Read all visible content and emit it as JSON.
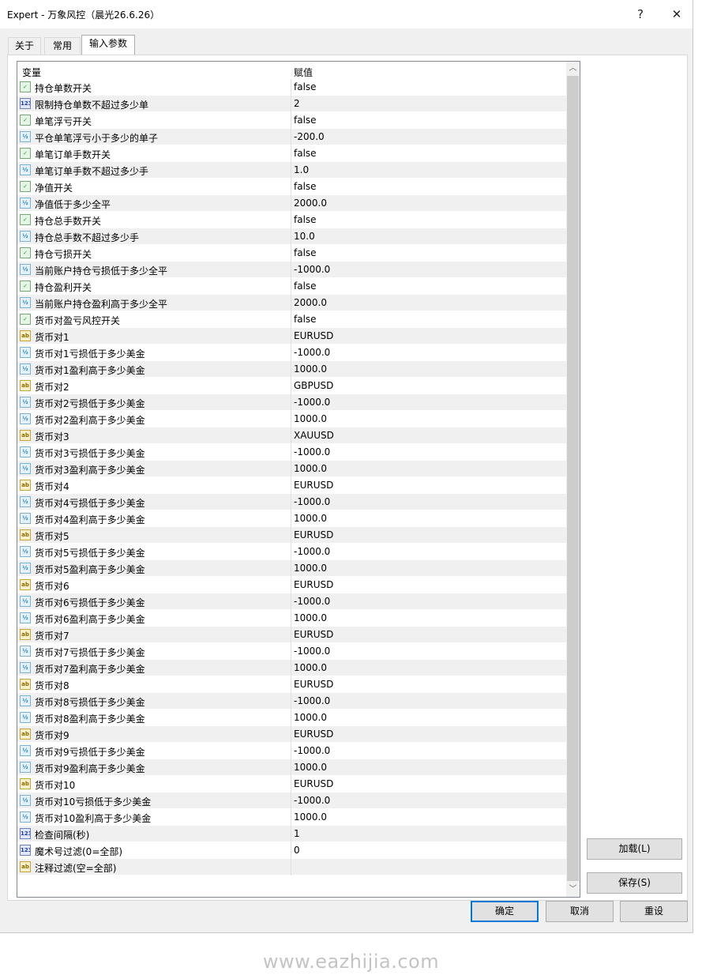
{
  "window": {
    "title": "Expert - 万象风控（晨光26.6.26）",
    "help_glyph": "?",
    "close_glyph": "✕"
  },
  "tabs": [
    {
      "label": "关于",
      "active": false
    },
    {
      "label": "常用",
      "active": false
    },
    {
      "label": "输入参数",
      "active": true
    }
  ],
  "grid": {
    "col_variable": "变量",
    "col_value": "赋值",
    "rows": [
      {
        "icon": "bool-icon",
        "badge": "✓",
        "name": "持仓单数开关",
        "value": "false"
      },
      {
        "icon": "int-icon",
        "badge": "123",
        "name": "限制持仓单数不超过多少单",
        "value": "2"
      },
      {
        "icon": "bool-icon",
        "badge": "✓",
        "name": "单笔浮亏开关",
        "value": "false"
      },
      {
        "icon": "double-icon",
        "badge": "½",
        "name": "平仓单笔浮亏小于多少的单子",
        "value": "-200.0"
      },
      {
        "icon": "bool-icon",
        "badge": "✓",
        "name": "单笔订单手数开关",
        "value": "false"
      },
      {
        "icon": "double-icon",
        "badge": "½",
        "name": "单笔订单手数不超过多少手",
        "value": "1.0"
      },
      {
        "icon": "bool-icon",
        "badge": "✓",
        "name": "净值开关",
        "value": "false"
      },
      {
        "icon": "double-icon",
        "badge": "½",
        "name": "净值低于多少全平",
        "value": "2000.0"
      },
      {
        "icon": "bool-icon",
        "badge": "✓",
        "name": "持仓总手数开关",
        "value": "false"
      },
      {
        "icon": "double-icon",
        "badge": "½",
        "name": "持仓总手数不超过多少手",
        "value": "10.0"
      },
      {
        "icon": "bool-icon",
        "badge": "✓",
        "name": "持仓亏损开关",
        "value": "false"
      },
      {
        "icon": "double-icon",
        "badge": "½",
        "name": "当前账户持仓亏损低于多少全平",
        "value": "-1000.0"
      },
      {
        "icon": "bool-icon",
        "badge": "✓",
        "name": "持仓盈利开关",
        "value": "false"
      },
      {
        "icon": "double-icon",
        "badge": "½",
        "name": "当前账户持仓盈利高于多少全平",
        "value": "2000.0"
      },
      {
        "icon": "bool-icon",
        "badge": "✓",
        "name": "货币对盈亏风控开关",
        "value": "false"
      },
      {
        "icon": "string-icon",
        "badge": "ab",
        "name": "货币对1",
        "value": "EURUSD"
      },
      {
        "icon": "double-icon",
        "badge": "½",
        "name": "货币对1亏损低于多少美金",
        "value": "-1000.0"
      },
      {
        "icon": "double-icon",
        "badge": "½",
        "name": "货币对1盈利高于多少美金",
        "value": "1000.0"
      },
      {
        "icon": "string-icon",
        "badge": "ab",
        "name": "货币对2",
        "value": "GBPUSD"
      },
      {
        "icon": "double-icon",
        "badge": "½",
        "name": "货币对2亏损低于多少美金",
        "value": "-1000.0"
      },
      {
        "icon": "double-icon",
        "badge": "½",
        "name": "货币对2盈利高于多少美金",
        "value": "1000.0"
      },
      {
        "icon": "string-icon",
        "badge": "ab",
        "name": "货币对3",
        "value": "XAUUSD"
      },
      {
        "icon": "double-icon",
        "badge": "½",
        "name": "货币对3亏损低于多少美金",
        "value": "-1000.0"
      },
      {
        "icon": "double-icon",
        "badge": "½",
        "name": "货币对3盈利高于多少美金",
        "value": "1000.0"
      },
      {
        "icon": "string-icon",
        "badge": "ab",
        "name": "货币对4",
        "value": "EURUSD"
      },
      {
        "icon": "double-icon",
        "badge": "½",
        "name": "货币对4亏损低于多少美金",
        "value": "-1000.0"
      },
      {
        "icon": "double-icon",
        "badge": "½",
        "name": "货币对4盈利高于多少美金",
        "value": "1000.0"
      },
      {
        "icon": "string-icon",
        "badge": "ab",
        "name": "货币对5",
        "value": "EURUSD"
      },
      {
        "icon": "double-icon",
        "badge": "½",
        "name": "货币对5亏损低于多少美金",
        "value": "-1000.0"
      },
      {
        "icon": "double-icon",
        "badge": "½",
        "name": "货币对5盈利高于多少美金",
        "value": "1000.0"
      },
      {
        "icon": "string-icon",
        "badge": "ab",
        "name": "货币对6",
        "value": "EURUSD"
      },
      {
        "icon": "double-icon",
        "badge": "½",
        "name": "货币对6亏损低于多少美金",
        "value": "-1000.0"
      },
      {
        "icon": "double-icon",
        "badge": "½",
        "name": "货币对6盈利高于多少美金",
        "value": "1000.0"
      },
      {
        "icon": "string-icon",
        "badge": "ab",
        "name": "货币对7",
        "value": "EURUSD"
      },
      {
        "icon": "double-icon",
        "badge": "½",
        "name": "货币对7亏损低于多少美金",
        "value": "-1000.0"
      },
      {
        "icon": "double-icon",
        "badge": "½",
        "name": "货币对7盈利高于多少美金",
        "value": "1000.0"
      },
      {
        "icon": "string-icon",
        "badge": "ab",
        "name": "货币对8",
        "value": "EURUSD"
      },
      {
        "icon": "double-icon",
        "badge": "½",
        "name": "货币对8亏损低于多少美金",
        "value": "-1000.0"
      },
      {
        "icon": "double-icon",
        "badge": "½",
        "name": "货币对8盈利高于多少美金",
        "value": "1000.0"
      },
      {
        "icon": "string-icon",
        "badge": "ab",
        "name": "货币对9",
        "value": "EURUSD"
      },
      {
        "icon": "double-icon",
        "badge": "½",
        "name": "货币对9亏损低于多少美金",
        "value": "-1000.0"
      },
      {
        "icon": "double-icon",
        "badge": "½",
        "name": "货币对9盈利高于多少美金",
        "value": "1000.0"
      },
      {
        "icon": "string-icon",
        "badge": "ab",
        "name": "货币对10",
        "value": "EURUSD"
      },
      {
        "icon": "double-icon",
        "badge": "½",
        "name": "货币对10亏损低于多少美金",
        "value": "-1000.0"
      },
      {
        "icon": "double-icon",
        "badge": "½",
        "name": "货币对10盈利高于多少美金",
        "value": "1000.0"
      },
      {
        "icon": "int-icon",
        "badge": "123",
        "name": "检查间隔(秒)",
        "value": "1"
      },
      {
        "icon": "int-icon",
        "badge": "123",
        "name": "魔术号过滤(0=全部)",
        "value": "0"
      },
      {
        "icon": "string-icon",
        "badge": "ab",
        "name": "注释过滤(空=全部)",
        "value": ""
      }
    ]
  },
  "side_buttons": {
    "load": "加载(L)",
    "save": "保存(S)"
  },
  "footer_buttons": {
    "ok": "确定",
    "cancel": "取消",
    "reset": "重设"
  },
  "watermark": "www.eazhijia.com"
}
